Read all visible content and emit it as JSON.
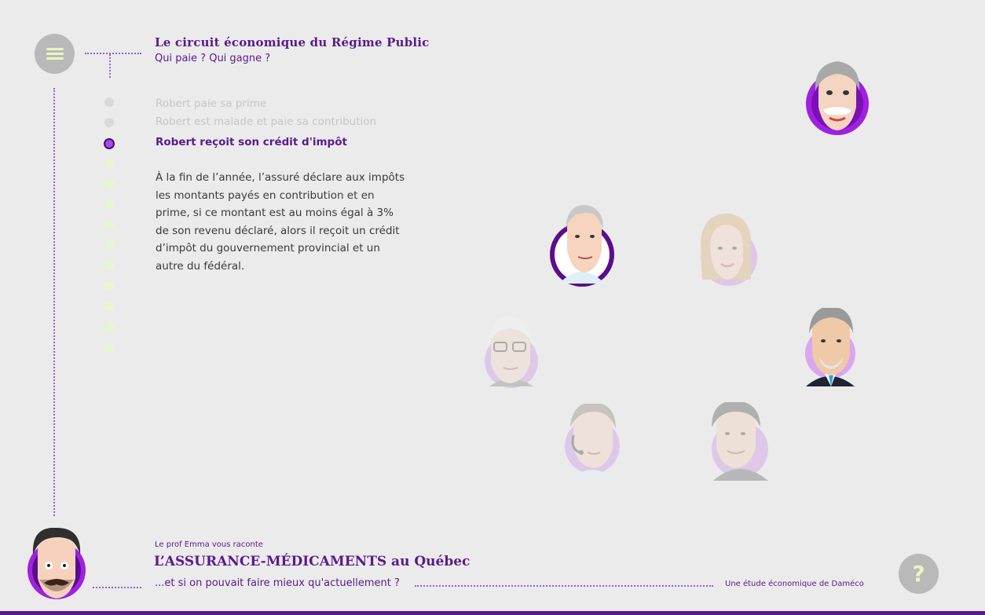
{
  "header": {
    "title": "Le circuit économique du Régime Public",
    "subtitle": "Qui paie ? Qui gagne ?"
  },
  "menu": {
    "icon": "hamburger-menu-icon"
  },
  "steps": [
    {
      "label": "Robert paie sa prime",
      "state": "done"
    },
    {
      "label": "Robert est malade et paie sa contribution",
      "state": "done"
    },
    {
      "label": "Robert reçoit son crédit d'impôt",
      "state": "active"
    },
    {
      "label": "",
      "state": "todo"
    },
    {
      "label": "",
      "state": "todo"
    },
    {
      "label": "",
      "state": "todo"
    },
    {
      "label": "",
      "state": "todo"
    },
    {
      "label": "",
      "state": "todo"
    },
    {
      "label": "",
      "state": "todo"
    },
    {
      "label": "",
      "state": "todo"
    },
    {
      "label": "",
      "state": "todo"
    },
    {
      "label": "",
      "state": "todo"
    },
    {
      "label": "",
      "state": "todo"
    }
  ],
  "description": "À la fin de l’année, l’assuré déclare aux impôts les montants payés en contribution et en prime, si ce montant est au moins égal à 3% de son revenu déclaré, alors il reçoit un crédit d’impôt du gouvernement provincial et un autre du fédéral.",
  "characters": [
    {
      "icon": "robert-avatar-icon",
      "state": "highlighted"
    },
    {
      "icon": "pharmacist-avatar-icon",
      "state": "highlighted"
    },
    {
      "icon": "woman-avatar-icon",
      "state": "faded"
    },
    {
      "icon": "elderly-man-glasses-avatar-icon",
      "state": "faded"
    },
    {
      "icon": "politician-avatar-icon",
      "state": "normal"
    },
    {
      "icon": "call-center-agent-avatar-icon",
      "state": "faded"
    },
    {
      "icon": "businessman-avatar-icon",
      "state": "faded"
    }
  ],
  "footer": {
    "kicker": "Le prof Emma vous raconte",
    "title": "L’ASSURANCE-MÉDICAMENTS au Québec",
    "tagline": "...et si on pouvait faire mieux qu'actuellement ?",
    "credit": "Une étude économique de Daméco",
    "help_label": "?"
  },
  "colors": {
    "background": "#ebebeb",
    "accent_purple": "#5b1a8c",
    "avatar_ring": "#a020e0",
    "menu_button": "#b9b9b9",
    "pending_dot": "#e6f6d2"
  }
}
